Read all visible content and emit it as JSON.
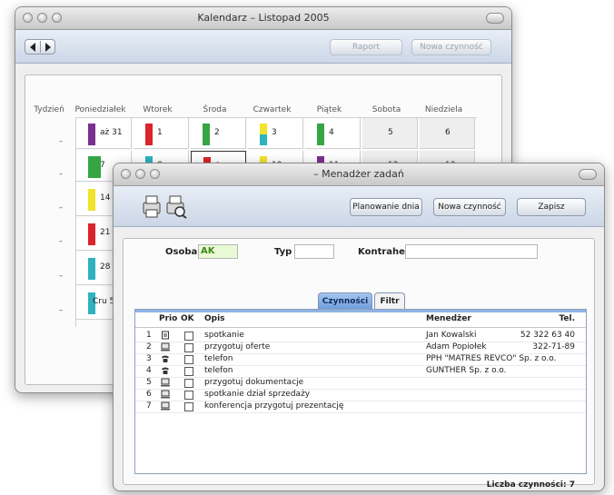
{
  "calendar": {
    "title": "Kalendarz – Listopad 2005",
    "raport_label": "Raport",
    "new_activity_label": "Nowa czynność",
    "week_header": "Tydzień",
    "days": [
      "Poniedziałek",
      "Wtorek",
      "Środa",
      "Czwartek",
      "Piątek",
      "Sobota",
      "Niedziela"
    ],
    "weeks": [
      "–",
      "–",
      "–",
      "–",
      "–",
      "–"
    ],
    "rows": [
      [
        "aż 31",
        "1",
        "2",
        "3",
        "4",
        "5",
        "6"
      ],
      [
        "7",
        "8",
        "9",
        "10",
        "11",
        "12",
        "13"
      ],
      [
        "14"
      ],
      [
        "21"
      ],
      [
        "28"
      ],
      [
        "Cru 5"
      ]
    ],
    "colors": {
      "purple": "#7b2f8f",
      "red": "#d9242a",
      "green": "#35a544",
      "yellow": "#f2e22c",
      "teal": "#2fb2c0"
    }
  },
  "task_manager": {
    "title": "– Menadżer zadań",
    "plan_label": "Planowanie dnia",
    "new_activity_label": "Nowa czynność",
    "save_label": "Zapisz",
    "osoba_label": "Osoba",
    "osoba_value": "AK",
    "typ_label": "Typ",
    "typ_value": "",
    "kontrahent_label": "Kontrahent",
    "kontrahent_value": "",
    "tabs": [
      "Czynności",
      "Filtr"
    ],
    "columns": {
      "prio": "Prio",
      "ok": "OK",
      "opis": "Opis",
      "manager": "Menedżer",
      "tel": "Tel."
    },
    "rows": [
      {
        "n": "1",
        "icon": "note-icon",
        "opis": "spotkanie",
        "manager": "Jan Kowalski",
        "tel": "52 322 63 40"
      },
      {
        "n": "2",
        "icon": "computer-icon",
        "opis": "przygotuj oferte",
        "manager": "Adam Popiołek",
        "tel": "322-71-89"
      },
      {
        "n": "3",
        "icon": "phone-icon",
        "opis": "telefon",
        "manager": "PPH \"MATRES REVCO\" Sp. z o.o.",
        "tel": ""
      },
      {
        "n": "4",
        "icon": "phone-icon",
        "opis": "telefon",
        "manager": "GUNTHER Sp. z o.o.",
        "tel": ""
      },
      {
        "n": "5",
        "icon": "computer-icon",
        "opis": "przygotuj dokumentacje",
        "manager": "",
        "tel": ""
      },
      {
        "n": "6",
        "icon": "computer-icon",
        "opis": "spotkanie dział sprzedaży",
        "manager": "",
        "tel": ""
      },
      {
        "n": "7",
        "icon": "computer-icon",
        "opis": "konferencja przygotuj prezentację",
        "manager": "",
        "tel": ""
      }
    ],
    "count_label": "Liczba czynności: 7"
  }
}
